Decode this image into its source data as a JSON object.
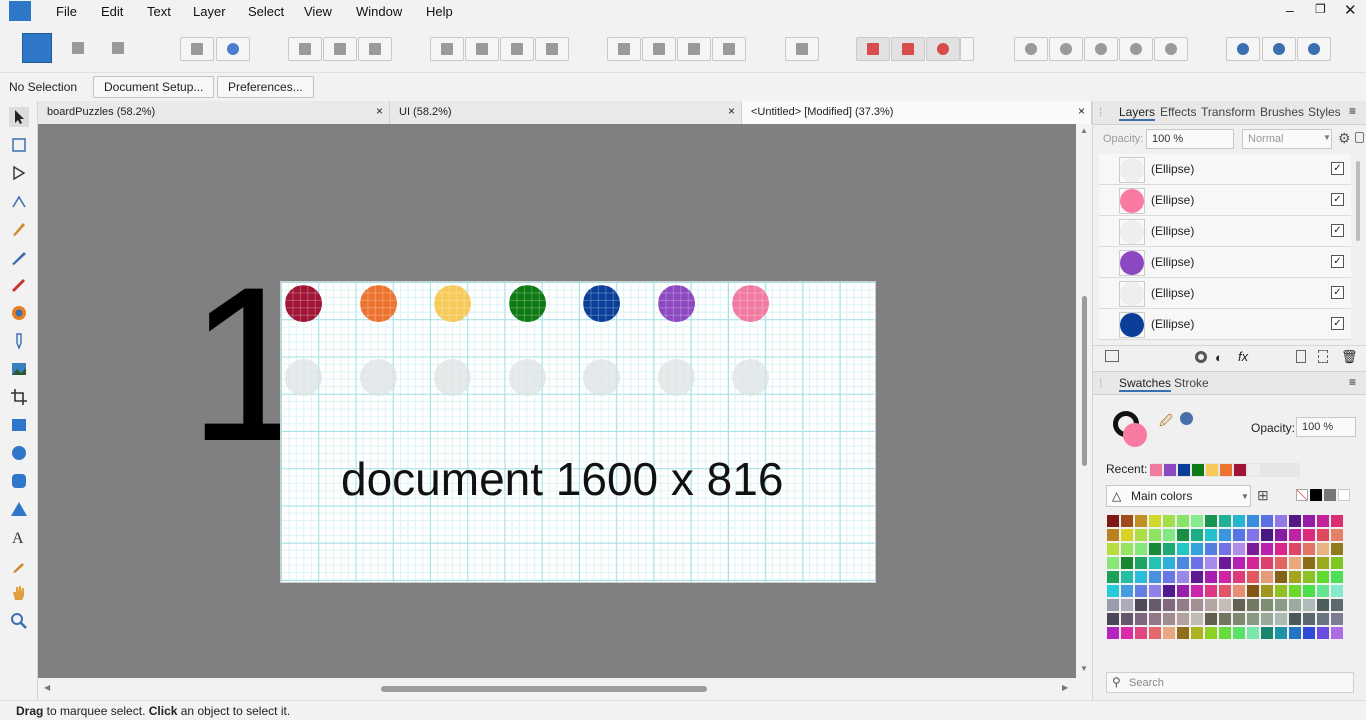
{
  "menu": [
    "File",
    "Edit",
    "Text",
    "Layer",
    "Select",
    "View",
    "Window",
    "Help"
  ],
  "context": {
    "selection": "No Selection",
    "doc_setup": "Document Setup...",
    "prefs": "Preferences..."
  },
  "tabs": [
    {
      "label": "boardPuzzles (58.2%)",
      "close": "×"
    },
    {
      "label": "UI (58.2%)",
      "close": "×"
    },
    {
      "label": "<Untitled> [Modified] (37.3%)",
      "close": "×"
    }
  ],
  "canvas": {
    "big_number": "1",
    "doc_text": "document 1600 x 816",
    "dot_colors": [
      "#a01535",
      "#ec7430",
      "#f6ca5a",
      "#0e7a14",
      "#0b3e98",
      "#8c48c0",
      "#f07aa0"
    ]
  },
  "panel": {
    "tabs": [
      "Layers",
      "Effects",
      "Transform",
      "Brushes",
      "Styles"
    ],
    "opacity_label": "Opacity:",
    "opacity_value": "100 %",
    "blend": "Normal",
    "layers": [
      {
        "name": "(Ellipse)",
        "color": "#eeeeee"
      },
      {
        "name": "(Ellipse)",
        "color": "#f87aa0"
      },
      {
        "name": "(Ellipse)",
        "color": "#eeeeee"
      },
      {
        "name": "(Ellipse)",
        "color": "#8c48c0"
      },
      {
        "name": "(Ellipse)",
        "color": "#eeeeee"
      },
      {
        "name": "(Ellipse)",
        "color": "#0b3e98"
      }
    ],
    "check": "✓",
    "sw_tabs": [
      "Swatches",
      "Stroke"
    ],
    "sw_opacity_label": "Opacity:",
    "sw_opacity_value": "100 %",
    "recent_label": "Recent:",
    "recent": [
      "#f07aa0",
      "#8c48c0",
      "#0b3e98",
      "#0e7a14",
      "#f6ca5a",
      "#ec7430",
      "#a01535",
      "#eeeeee"
    ],
    "palette_name": "Main colors",
    "search_placeholder": "Search"
  },
  "status": {
    "drag": "Drag",
    "t1": " to marquee select. ",
    "click": "Click",
    "t2": " an object to select it."
  }
}
